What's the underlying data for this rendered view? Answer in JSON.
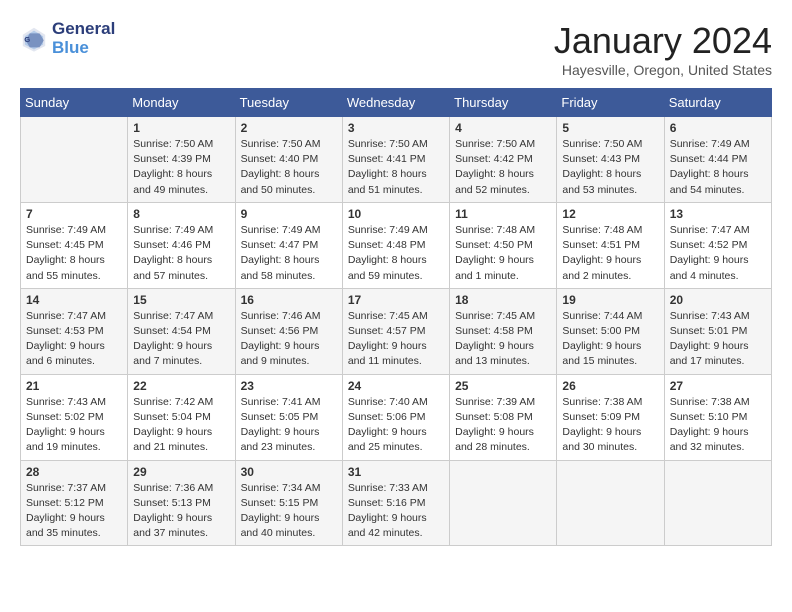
{
  "header": {
    "logo_line1": "General",
    "logo_line2": "Blue",
    "month_title": "January 2024",
    "location": "Hayesville, Oregon, United States"
  },
  "weekdays": [
    "Sunday",
    "Monday",
    "Tuesday",
    "Wednesday",
    "Thursday",
    "Friday",
    "Saturday"
  ],
  "weeks": [
    [
      {
        "day": "",
        "info": ""
      },
      {
        "day": "1",
        "info": "Sunrise: 7:50 AM\nSunset: 4:39 PM\nDaylight: 8 hours\nand 49 minutes."
      },
      {
        "day": "2",
        "info": "Sunrise: 7:50 AM\nSunset: 4:40 PM\nDaylight: 8 hours\nand 50 minutes."
      },
      {
        "day": "3",
        "info": "Sunrise: 7:50 AM\nSunset: 4:41 PM\nDaylight: 8 hours\nand 51 minutes."
      },
      {
        "day": "4",
        "info": "Sunrise: 7:50 AM\nSunset: 4:42 PM\nDaylight: 8 hours\nand 52 minutes."
      },
      {
        "day": "5",
        "info": "Sunrise: 7:50 AM\nSunset: 4:43 PM\nDaylight: 8 hours\nand 53 minutes."
      },
      {
        "day": "6",
        "info": "Sunrise: 7:49 AM\nSunset: 4:44 PM\nDaylight: 8 hours\nand 54 minutes."
      }
    ],
    [
      {
        "day": "7",
        "info": "Sunrise: 7:49 AM\nSunset: 4:45 PM\nDaylight: 8 hours\nand 55 minutes."
      },
      {
        "day": "8",
        "info": "Sunrise: 7:49 AM\nSunset: 4:46 PM\nDaylight: 8 hours\nand 57 minutes."
      },
      {
        "day": "9",
        "info": "Sunrise: 7:49 AM\nSunset: 4:47 PM\nDaylight: 8 hours\nand 58 minutes."
      },
      {
        "day": "10",
        "info": "Sunrise: 7:49 AM\nSunset: 4:48 PM\nDaylight: 8 hours\nand 59 minutes."
      },
      {
        "day": "11",
        "info": "Sunrise: 7:48 AM\nSunset: 4:50 PM\nDaylight: 9 hours\nand 1 minute."
      },
      {
        "day": "12",
        "info": "Sunrise: 7:48 AM\nSunset: 4:51 PM\nDaylight: 9 hours\nand 2 minutes."
      },
      {
        "day": "13",
        "info": "Sunrise: 7:47 AM\nSunset: 4:52 PM\nDaylight: 9 hours\nand 4 minutes."
      }
    ],
    [
      {
        "day": "14",
        "info": "Sunrise: 7:47 AM\nSunset: 4:53 PM\nDaylight: 9 hours\nand 6 minutes."
      },
      {
        "day": "15",
        "info": "Sunrise: 7:47 AM\nSunset: 4:54 PM\nDaylight: 9 hours\nand 7 minutes."
      },
      {
        "day": "16",
        "info": "Sunrise: 7:46 AM\nSunset: 4:56 PM\nDaylight: 9 hours\nand 9 minutes."
      },
      {
        "day": "17",
        "info": "Sunrise: 7:45 AM\nSunset: 4:57 PM\nDaylight: 9 hours\nand 11 minutes."
      },
      {
        "day": "18",
        "info": "Sunrise: 7:45 AM\nSunset: 4:58 PM\nDaylight: 9 hours\nand 13 minutes."
      },
      {
        "day": "19",
        "info": "Sunrise: 7:44 AM\nSunset: 5:00 PM\nDaylight: 9 hours\nand 15 minutes."
      },
      {
        "day": "20",
        "info": "Sunrise: 7:43 AM\nSunset: 5:01 PM\nDaylight: 9 hours\nand 17 minutes."
      }
    ],
    [
      {
        "day": "21",
        "info": "Sunrise: 7:43 AM\nSunset: 5:02 PM\nDaylight: 9 hours\nand 19 minutes."
      },
      {
        "day": "22",
        "info": "Sunrise: 7:42 AM\nSunset: 5:04 PM\nDaylight: 9 hours\nand 21 minutes."
      },
      {
        "day": "23",
        "info": "Sunrise: 7:41 AM\nSunset: 5:05 PM\nDaylight: 9 hours\nand 23 minutes."
      },
      {
        "day": "24",
        "info": "Sunrise: 7:40 AM\nSunset: 5:06 PM\nDaylight: 9 hours\nand 25 minutes."
      },
      {
        "day": "25",
        "info": "Sunrise: 7:39 AM\nSunset: 5:08 PM\nDaylight: 9 hours\nand 28 minutes."
      },
      {
        "day": "26",
        "info": "Sunrise: 7:38 AM\nSunset: 5:09 PM\nDaylight: 9 hours\nand 30 minutes."
      },
      {
        "day": "27",
        "info": "Sunrise: 7:38 AM\nSunset: 5:10 PM\nDaylight: 9 hours\nand 32 minutes."
      }
    ],
    [
      {
        "day": "28",
        "info": "Sunrise: 7:37 AM\nSunset: 5:12 PM\nDaylight: 9 hours\nand 35 minutes."
      },
      {
        "day": "29",
        "info": "Sunrise: 7:36 AM\nSunset: 5:13 PM\nDaylight: 9 hours\nand 37 minutes."
      },
      {
        "day": "30",
        "info": "Sunrise: 7:34 AM\nSunset: 5:15 PM\nDaylight: 9 hours\nand 40 minutes."
      },
      {
        "day": "31",
        "info": "Sunrise: 7:33 AM\nSunset: 5:16 PM\nDaylight: 9 hours\nand 42 minutes."
      },
      {
        "day": "",
        "info": ""
      },
      {
        "day": "",
        "info": ""
      },
      {
        "day": "",
        "info": ""
      }
    ]
  ]
}
